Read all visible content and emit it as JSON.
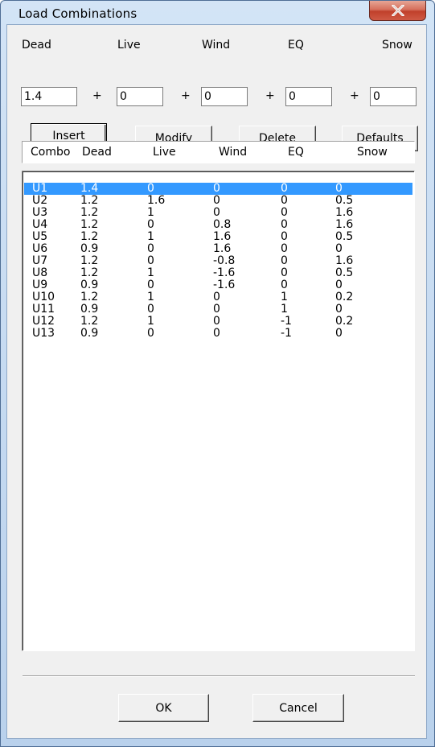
{
  "window": {
    "title": "Load Combinations"
  },
  "factors": {
    "labels": {
      "dead": "Dead",
      "live": "Live",
      "wind": "Wind",
      "eq": "EQ",
      "snow": "Snow"
    },
    "values": {
      "dead": "1.4",
      "live": "0",
      "wind": "0",
      "eq": "0",
      "snow": "0"
    },
    "plus": "+"
  },
  "buttons": {
    "insert": "Insert",
    "modify": "Modify",
    "delete": "Delete",
    "defaults": "Defaults",
    "ok": "OK",
    "cancel": "Cancel"
  },
  "table": {
    "headers": [
      "Combo",
      "Dead",
      "Live",
      "Wind",
      "EQ",
      "Snow"
    ],
    "rows": [
      [
        "U1",
        "1.4",
        "0",
        "0",
        "0",
        "0"
      ],
      [
        "U2",
        "1.2",
        "1.6",
        "0",
        "0",
        "0.5"
      ],
      [
        "U3",
        "1.2",
        "1",
        "0",
        "0",
        "1.6"
      ],
      [
        "U4",
        "1.2",
        "0",
        "0.8",
        "0",
        "1.6"
      ],
      [
        "U5",
        "1.2",
        "1",
        "1.6",
        "0",
        "0.5"
      ],
      [
        "U6",
        "0.9",
        "0",
        "1.6",
        "0",
        "0"
      ],
      [
        "U7",
        "1.2",
        "0",
        "-0.8",
        "0",
        "1.6"
      ],
      [
        "U8",
        "1.2",
        "1",
        "-1.6",
        "0",
        "0.5"
      ],
      [
        "U9",
        "0.9",
        "0",
        "-1.6",
        "0",
        "0"
      ],
      [
        "U10",
        "1.2",
        "1",
        "0",
        "1",
        "0.2"
      ],
      [
        "U11",
        "0.9",
        "0",
        "0",
        "1",
        "0"
      ],
      [
        "U12",
        "1.2",
        "1",
        "0",
        "-1",
        "0.2"
      ],
      [
        "U13",
        "0.9",
        "0",
        "0",
        "-1",
        "0"
      ]
    ],
    "selected_row": "U1"
  },
  "colors": {
    "selection": "#3399ff",
    "close_button": "#c75a45",
    "titlebar": "#c8dcf2"
  }
}
